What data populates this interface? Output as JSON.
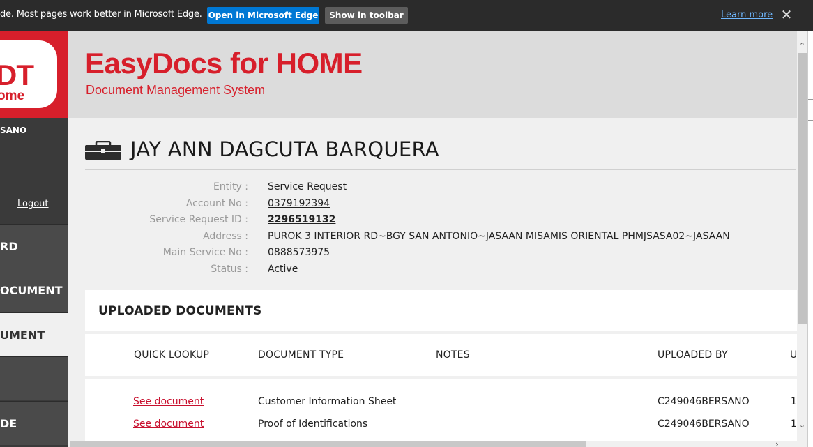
{
  "banner": {
    "message": "de. Most pages work better in Microsoft Edge.",
    "open_edge": "Open in Microsoft Edge",
    "show_toolbar": "Show in toolbar",
    "learn_more": "Learn more",
    "close_glyph": "✕"
  },
  "sidebar": {
    "logo_text": "DT",
    "logo_sub": "ome",
    "user": "SANO",
    "logout": "Logout",
    "items": [
      {
        "label": "RD"
      },
      {
        "label": "OCUMENT"
      },
      {
        "label": "UMENT"
      },
      {
        "label": ""
      },
      {
        "label": "DE"
      }
    ]
  },
  "header": {
    "title": "EasyDocs for HOME",
    "subtitle": "Document Management System"
  },
  "record": {
    "name": "JAY ANN DAGCUTA BARQUERA",
    "fields": [
      {
        "label": "Entity :",
        "value": "Service Request"
      },
      {
        "label": "Account No :",
        "value": "0379192394"
      },
      {
        "label": "Service Request ID :",
        "value": "2296519132"
      },
      {
        "label": "Address :",
        "value": "PUROK 3 INTERIOR RD~BGY SAN ANTONIO~JASAAN MISAMIS ORIENTAL PHMJSASA02~JASAAN"
      },
      {
        "label": "Main Service No :",
        "value": "0888573975"
      },
      {
        "label": "Status :",
        "value": "Active"
      }
    ]
  },
  "documents": {
    "title": "UPLOADED DOCUMENTS",
    "columns": [
      "QUICK LOOKUP",
      "DOCUMENT TYPE",
      "NOTES",
      "UPLOADED BY",
      "U"
    ],
    "rows": [
      {
        "lookup": "See document",
        "type": "Customer Information Sheet",
        "notes": "",
        "uploaded_by": "C249046BERSANO",
        "extra": "1"
      },
      {
        "lookup": "See document",
        "type": "Proof of Identifications",
        "notes": "",
        "uploaded_by": "C249046BERSANO",
        "extra": "1"
      }
    ]
  },
  "colors": {
    "brand_red": "#d71f2b",
    "edge_blue": "#0078d4",
    "link_red": "#c8102e"
  }
}
